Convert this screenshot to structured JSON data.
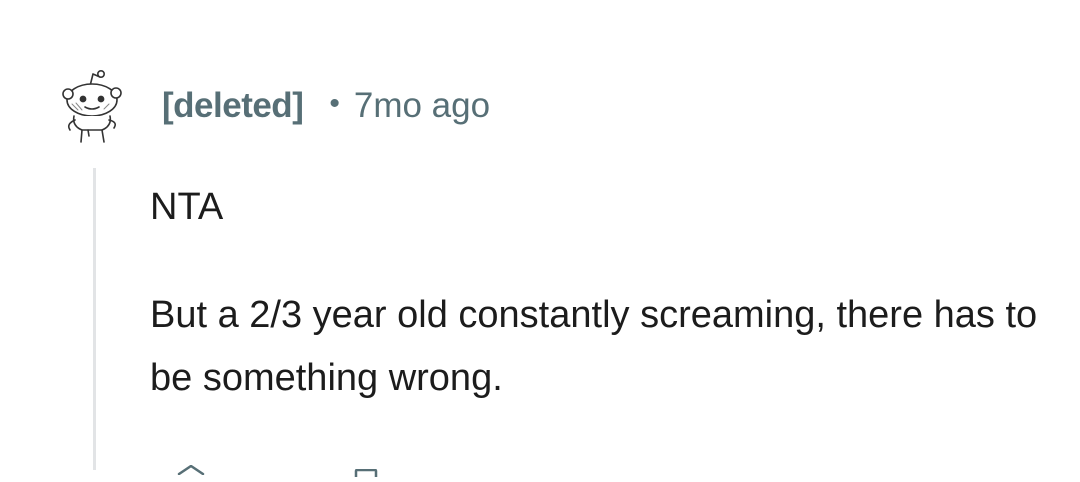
{
  "comment": {
    "author": "[deleted]",
    "separator": "•",
    "timestamp": "7mo ago",
    "avatar_icon": "snoo-avatar-icon",
    "paragraphs": [
      "NTA",
      "But a 2/3 year old constantly screaming, there has to be something wrong."
    ]
  },
  "actions": {
    "icons": [
      "upvote-icon",
      "reply-icon"
    ]
  },
  "colors": {
    "meta_text": "#576f76",
    "body_text": "#1c1c1c",
    "thread_line": "#e2e4e6",
    "background": "#ffffff"
  }
}
